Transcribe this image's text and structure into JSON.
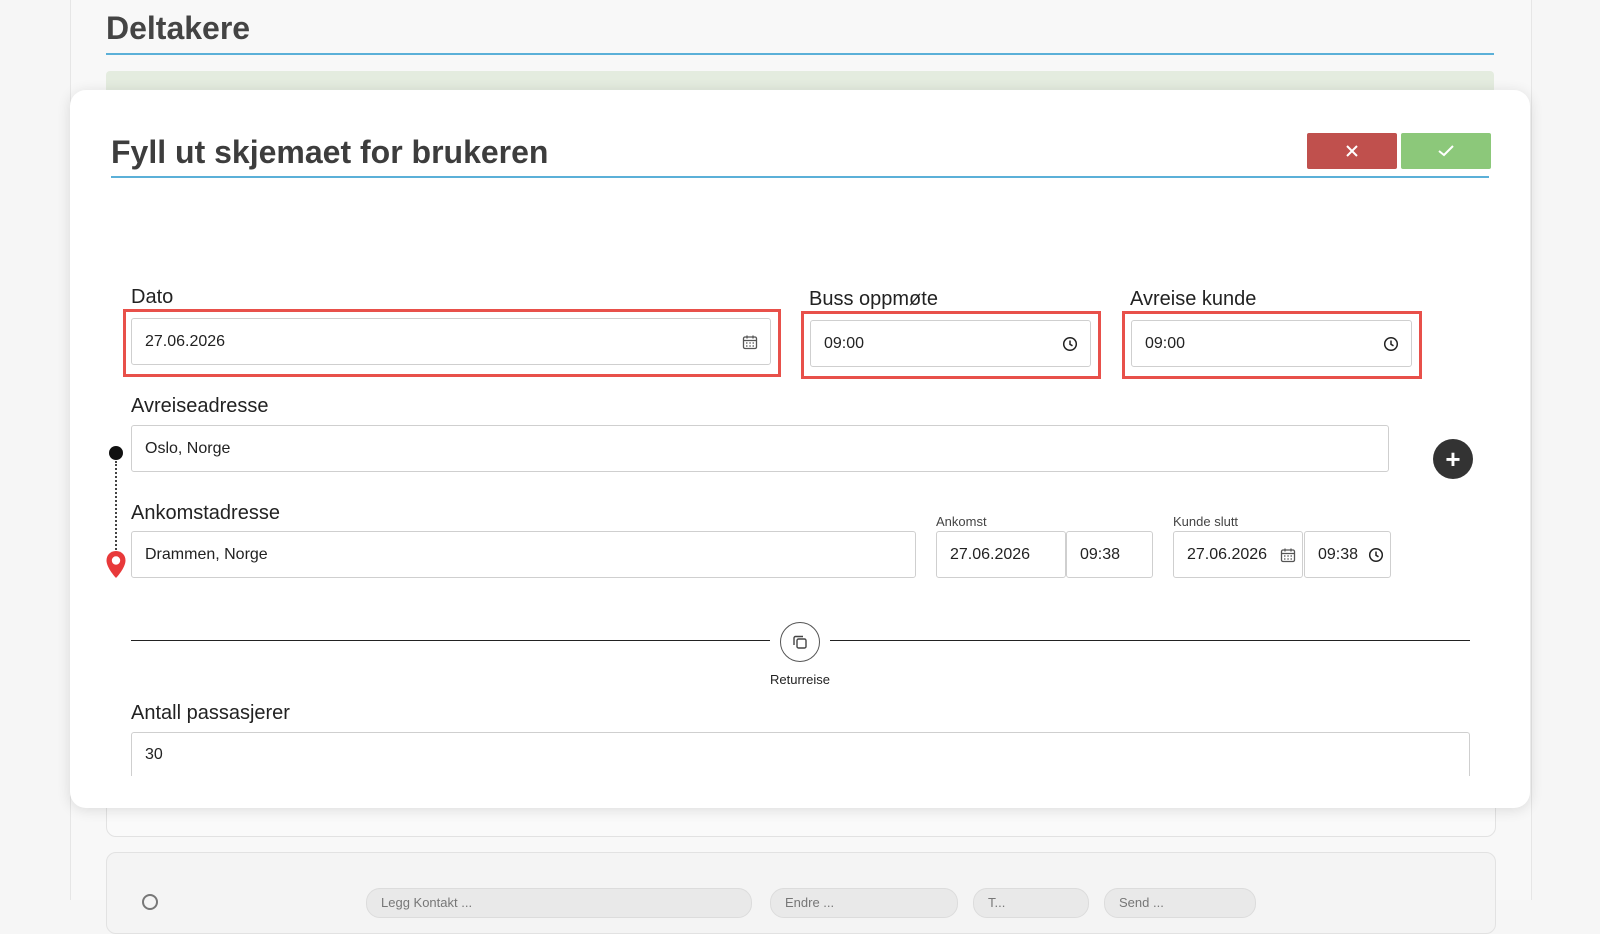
{
  "background": {
    "page_title": "Deltakere",
    "chips": [
      "Legg Kontakt ...",
      "Endre ...",
      "T...",
      "Send ..."
    ]
  },
  "modal": {
    "title": "Fyll ut skjemaet for brukeren",
    "buttons": {
      "cancel_icon": "close-icon",
      "confirm_icon": "check-icon"
    },
    "fields": {
      "dato": {
        "label": "Dato",
        "value": "27.06.2026"
      },
      "buss": {
        "label": "Buss oppmøte",
        "value": "09:00"
      },
      "avreise_kunde": {
        "label": "Avreise kunde",
        "value": "09:00"
      },
      "avreiseadresse": {
        "label": "Avreiseadresse",
        "value": "Oslo, Norge"
      },
      "ankomstadresse": {
        "label": "Ankomstadresse",
        "value": "Drammen, Norge"
      },
      "ankomst": {
        "label": "Ankomst",
        "date": "27.06.2026",
        "time": "09:38"
      },
      "kunde_slutt": {
        "label": "Kunde slutt",
        "date": "27.06.2026",
        "time": "09:38"
      },
      "returreise": {
        "label": "Returreise"
      },
      "antall": {
        "label": "Antall passasjerer",
        "value": "30"
      }
    }
  },
  "colors": {
    "accent": "#5bb0d8",
    "cancel": "#c0504d",
    "confirm": "#8cc87a",
    "highlight": "#e8504a",
    "pin": "#e8393a"
  }
}
